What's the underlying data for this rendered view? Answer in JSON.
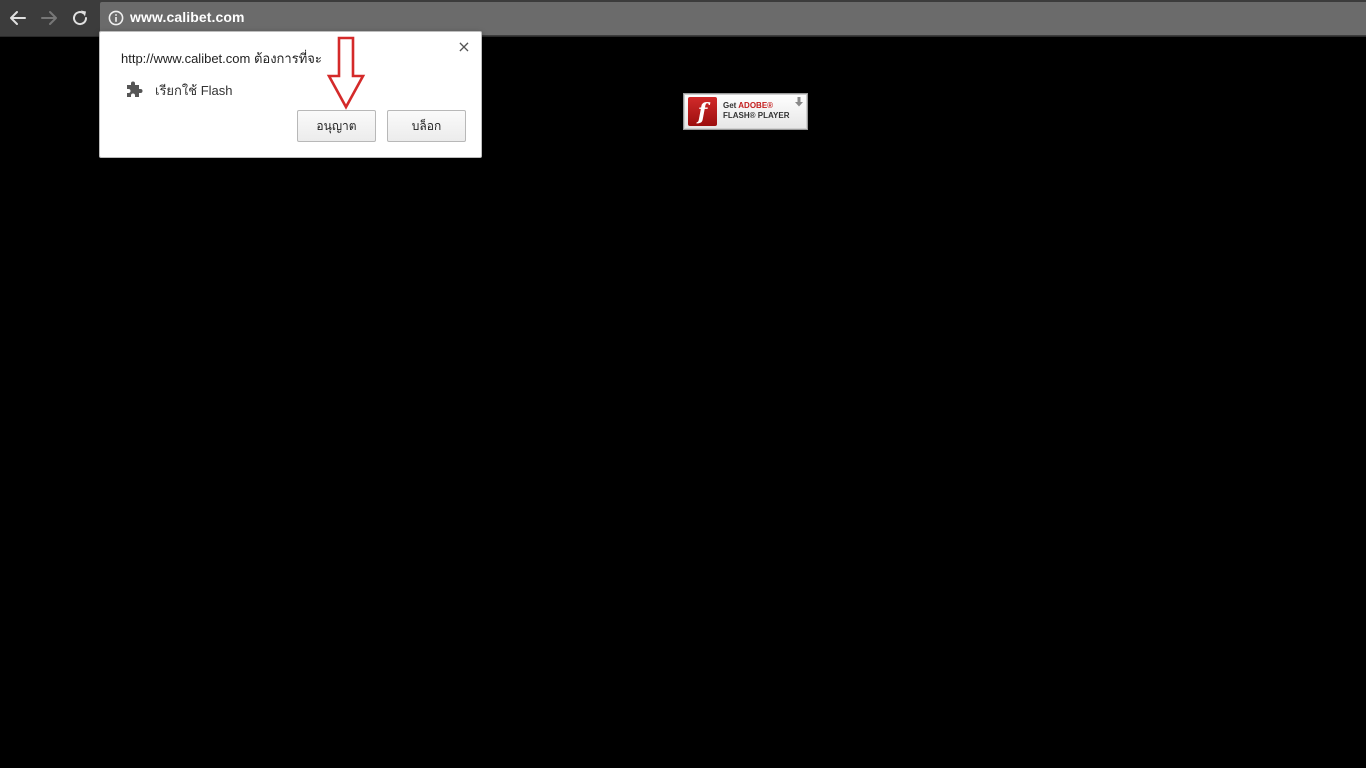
{
  "browser": {
    "url": "www.calibet.com",
    "back_icon": "back-arrow-icon",
    "forward_icon": "forward-arrow-icon",
    "reload_icon": "reload-icon",
    "info_icon": "info-icon"
  },
  "popup": {
    "title": "http://www.calibet.com ต้องการที่จะ",
    "permission_label": "เรียกใช้ Flash",
    "permission_icon": "puzzle-plugin-icon",
    "allow_label": "อนุญาต",
    "block_label": "บล็อก",
    "close_label": "×"
  },
  "flash_badge": {
    "get_label": "Get",
    "adobe_label": "ADOBE®",
    "player_label": "FLASH® PLAYER",
    "logo_letter": "f"
  },
  "colors": {
    "toolbar": "#3c3c3c",
    "omnibox": "#6b6b6b",
    "annotation_arrow": "#d42a2a",
    "flash_red": "#c31d1d"
  }
}
